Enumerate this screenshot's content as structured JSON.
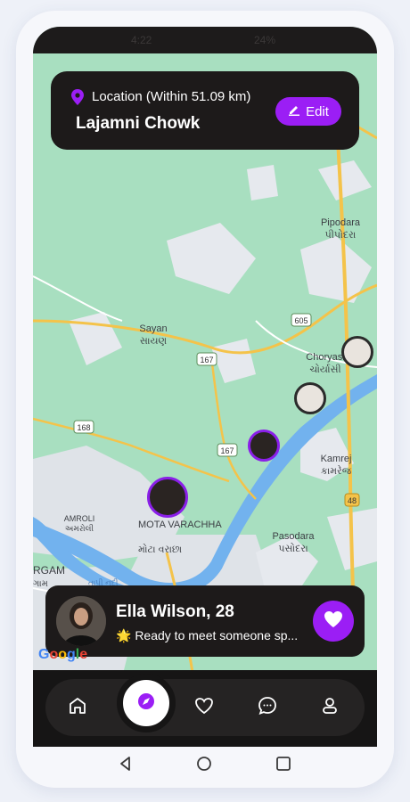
{
  "statusbar": {
    "time": "4:22",
    "indicators": "24%"
  },
  "location": {
    "label": "Location (Within 51.09 km)",
    "name": "Lajamni Chowk",
    "edit_label": "Edit"
  },
  "map": {
    "places": [
      {
        "en": "Pipodara",
        "gu": "પીપોદરા"
      },
      {
        "en": "Sayan",
        "gu": "સાયણ"
      },
      {
        "en": "Choryasi",
        "gu": "ચોર્યાસી"
      },
      {
        "en": "Kamrej",
        "gu": "કામરેજ"
      },
      {
        "en": "AMROLI",
        "gu": "અમરોલી"
      },
      {
        "en": "MOTA VARACHHA",
        "gu": "મોટા વરાછા"
      },
      {
        "en": "Pasodara",
        "gu": "પસોદરા"
      },
      {
        "en": "RGAM",
        "gu": "ગામ"
      }
    ],
    "roads": [
      "605",
      "167",
      "168",
      "167",
      "48"
    ],
    "river": "તાપી નદી",
    "google": "Google"
  },
  "profile": {
    "name": "Ella Wilson, 28",
    "status": "🌟 Ready to meet someone sp..."
  },
  "nav": [
    "home",
    "explore",
    "likes",
    "chat",
    "profile"
  ],
  "colors": {
    "accent": "#9b1ef5",
    "card": "#1d1a1a",
    "map_green": "#a8dfc0",
    "river": "#6fb0ef",
    "road": "#f4c34a"
  }
}
